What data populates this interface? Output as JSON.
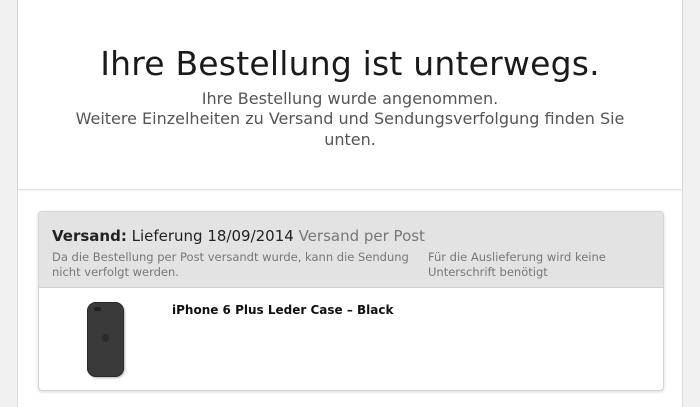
{
  "hero": {
    "title": "Ihre Bestellung ist unterwegs.",
    "line1": "Ihre Bestellung wurde angenommen.",
    "line2": "Weitere Einzelheiten zu Versand und Sendungsverfolgung finden Sie unten."
  },
  "shipment": {
    "label": "Versand:",
    "delivery": "Lieferung 18/09/2014",
    "method": "Versand per Post",
    "note_left": "Da die Bestellung per Post versandt wurde, kann die Sendung nicht verfolgt werden.",
    "note_right": "Für die Auslieferung wird keine Unterschrift benötigt"
  },
  "product": {
    "name": "iPhone 6 Plus Leder Case – Black",
    "image_icon": "phone-case-icon"
  },
  "colors": {
    "background": "#f1f1f1",
    "card_header": "#e3e3e3",
    "case": "#3a3a3a"
  }
}
